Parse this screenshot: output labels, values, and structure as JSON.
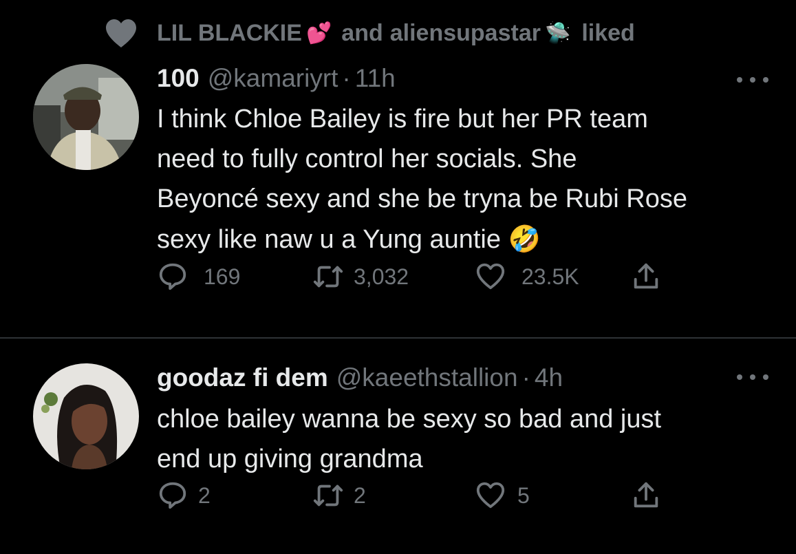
{
  "social_context": {
    "user1": "LIL BLACKIE",
    "user1_emoji": "💕",
    "connector": "and",
    "user2": "aliensupastar",
    "user2_emoji": "🛸",
    "action": "liked"
  },
  "tweets": [
    {
      "name": "100",
      "handle": "@kamariyrt",
      "separator": "·",
      "time": "11h",
      "lines": [
        "I think Chloe Bailey is fire but her PR team",
        "need to fully control her socials. She",
        "Beyoncé sexy and she be tryna be Rubi Rose",
        "sexy like naw u a Yung auntie "
      ],
      "emoji": "🤣",
      "replies": "169",
      "retweets": "3,032",
      "likes": "23.5K"
    },
    {
      "name": "goodaz fi dem",
      "handle": "@kaeethstallion",
      "separator": "·",
      "time": "4h",
      "lines": [
        "chloe bailey wanna be sexy so bad and just",
        "end up giving grandma"
      ],
      "replies": "2",
      "retweets": "2",
      "likes": "5"
    }
  ],
  "colors": {
    "background": "#000000",
    "text_primary": "#e7e9ea",
    "text_secondary": "#71767b",
    "divider": "#2f3336"
  },
  "icons": [
    "heart-filled-icon",
    "more-icon",
    "reply-icon",
    "retweet-icon",
    "like-icon",
    "share-icon"
  ]
}
